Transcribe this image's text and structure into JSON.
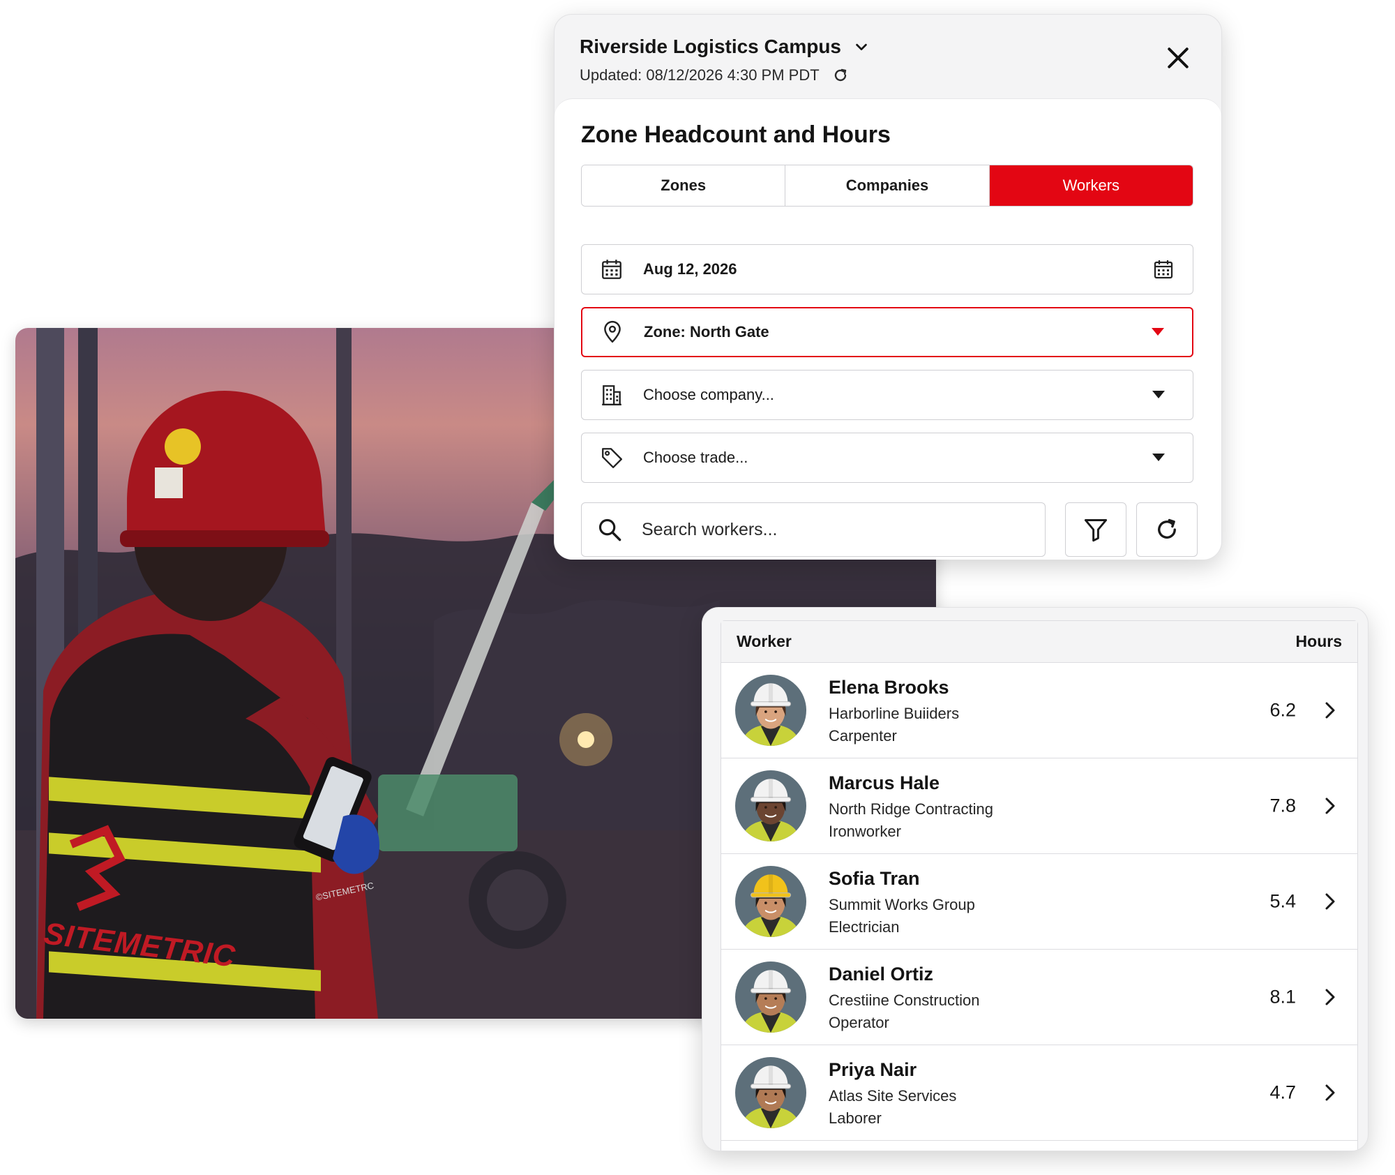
{
  "header": {
    "site_name": "Riverside Logistics Campus",
    "updated": "Updated: 08/12/2026 4:30 PM PDT"
  },
  "panel": {
    "title": "Zone Headcount and Hours",
    "tabs": [
      {
        "label": "Zones",
        "active": false
      },
      {
        "label": "Companies",
        "active": false
      },
      {
        "label": "Workers",
        "active": true
      }
    ]
  },
  "filters": {
    "date": "Aug 12, 2026",
    "zone": "Zone: North Gate",
    "company_placeholder": "Choose company...",
    "trade_placeholder": "Choose trade...",
    "search_placeholder": "Search workers..."
  },
  "photo": {
    "vest_text": "SITEMETRIC",
    "sleeve_text": "©SITEMETRC"
  },
  "table": {
    "col_worker": "Worker",
    "col_hours": "Hours",
    "rows": [
      {
        "name": "Elena Brooks",
        "company": "Harborline Buiiders",
        "trade": "Carpenter",
        "hours": "6.2",
        "helmet": "#f2f2f2",
        "skin": "#d9a47f",
        "hair": "#4a2f1f"
      },
      {
        "name": "Marcus Hale",
        "company": "North Ridge Contracting",
        "trade": "Ironworker",
        "hours": "7.8",
        "helmet": "#f2f2f2",
        "skin": "#6b4431",
        "hair": "#1c1410"
      },
      {
        "name": "Sofia Tran",
        "company": "Summit Works Group",
        "trade": "Electrician",
        "hours": "5.4",
        "helmet": "#f1c21b",
        "skin": "#c98f68",
        "hair": "#241a14"
      },
      {
        "name": "Daniel Ortiz",
        "company": "Crestiine Construction",
        "trade": "Operator",
        "hours": "8.1",
        "helmet": "#f2f2f2",
        "skin": "#b57d57",
        "hair": "#2a1d15"
      },
      {
        "name": "Priya Nair",
        "company": "Atlas Site Services",
        "trade": "Laborer",
        "hours": "4.7",
        "helmet": "#f2f2f2",
        "skin": "#b07a55",
        "hair": "#1f1510"
      }
    ]
  },
  "colors": {
    "accent": "#e30613",
    "vest_stripe": "#d4d629"
  },
  "icons": [
    "chevron-down-icon",
    "refresh-icon",
    "close-icon",
    "calendar-icon",
    "location-pin-icon",
    "building-icon",
    "tag-icon",
    "caret-down-icon",
    "search-icon",
    "filter-icon",
    "chevron-right-icon"
  ]
}
